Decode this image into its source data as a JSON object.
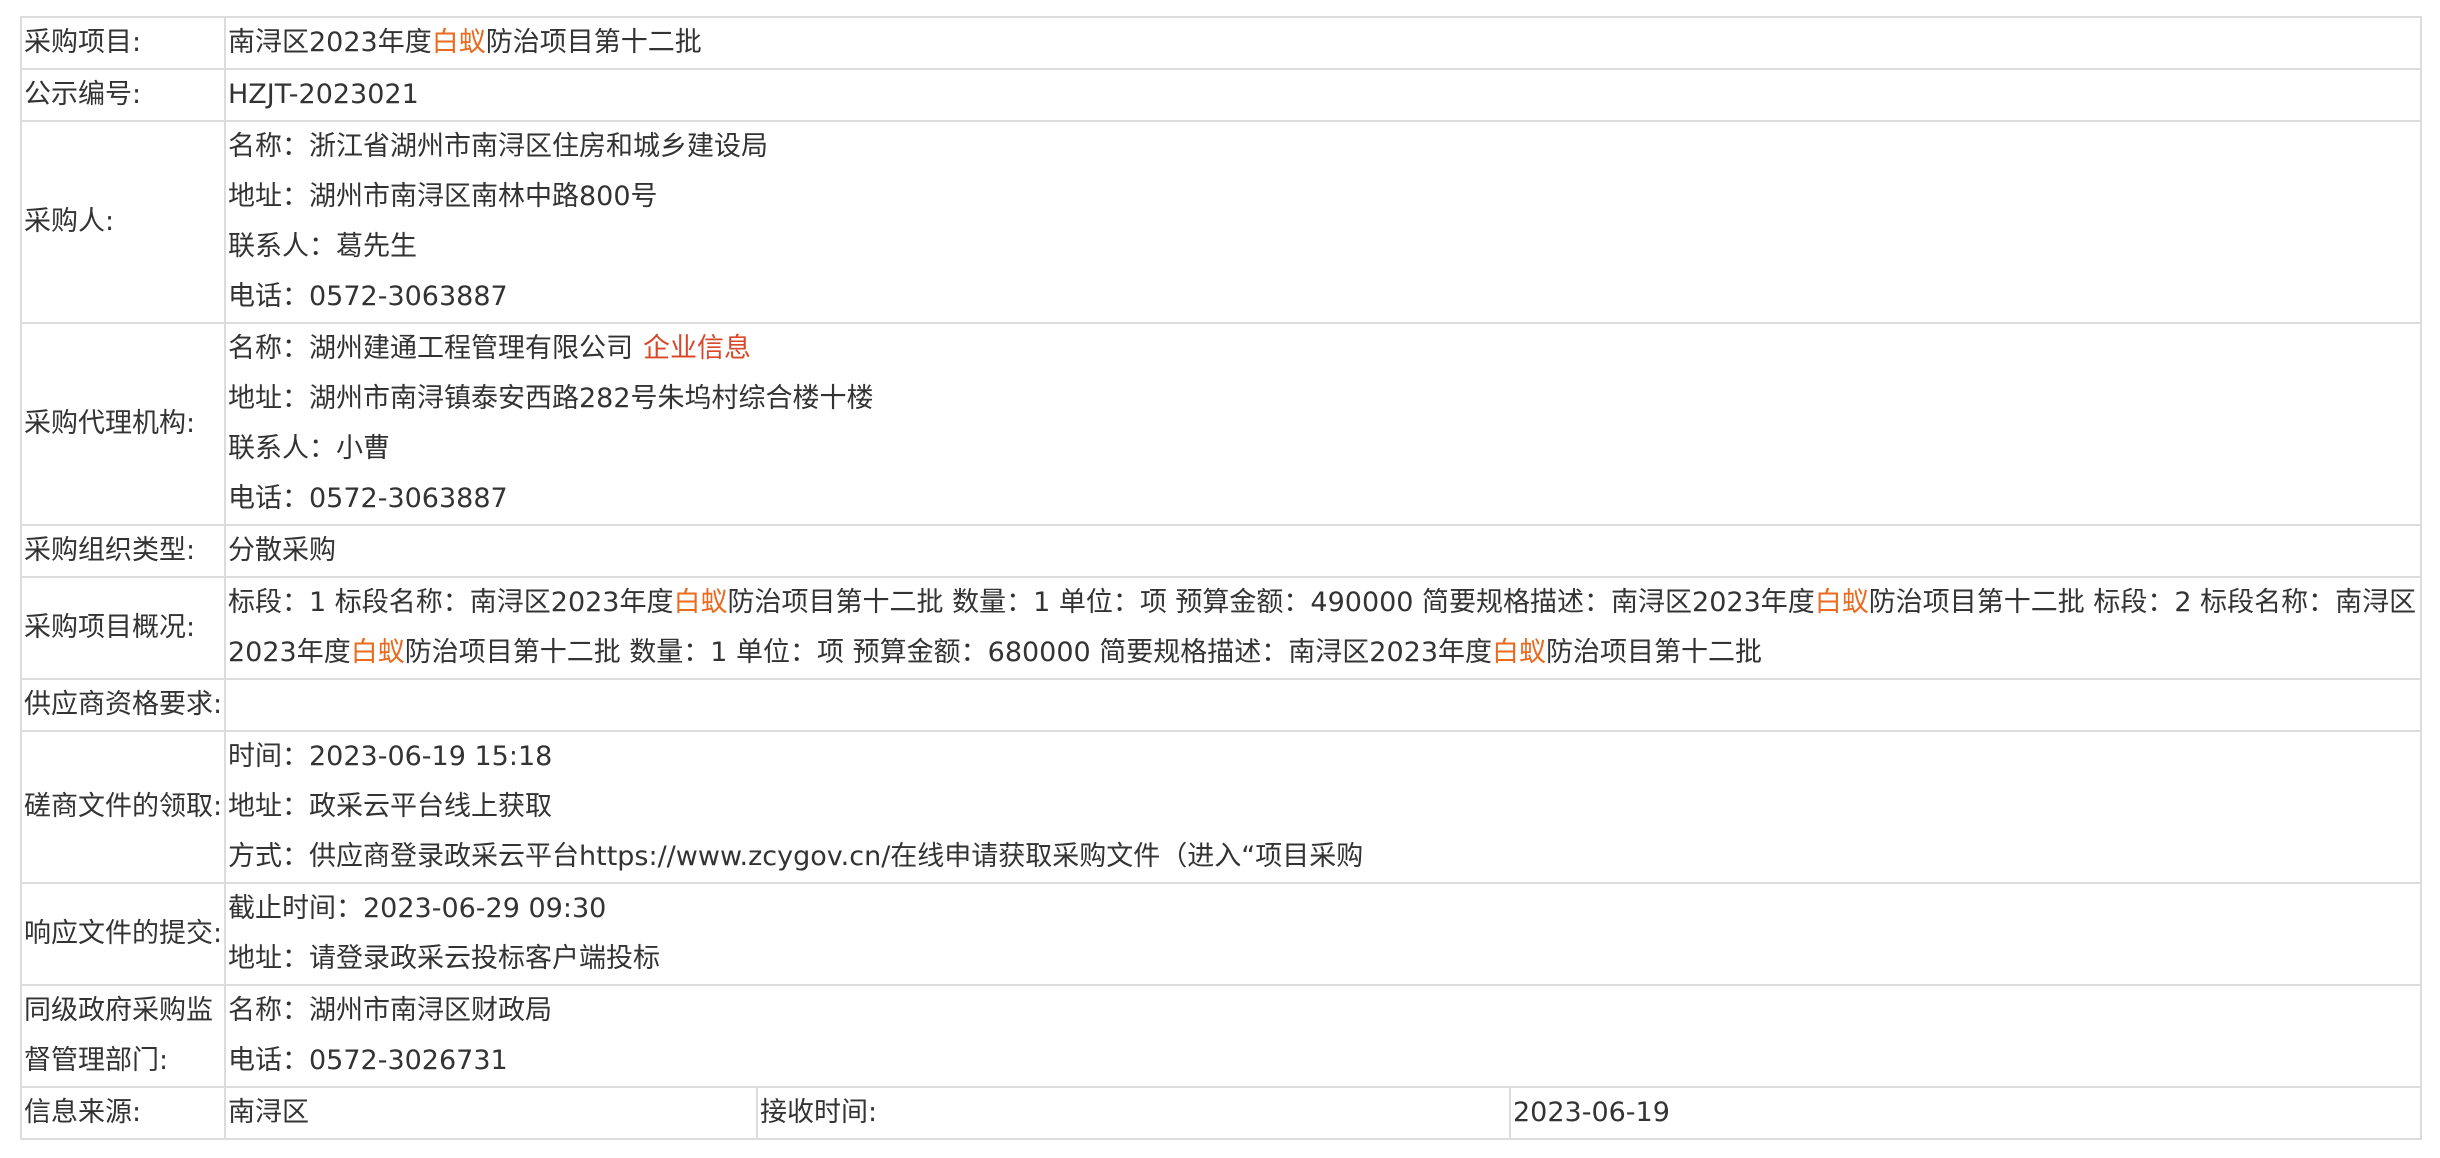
{
  "highlight_color": "#ea6a1f",
  "link_color": "#d9482b",
  "project": {
    "label": "采购项目:",
    "pre": "南浔区2023年度",
    "hl": "白蚁",
    "post": "防治项目第十二批"
  },
  "notice_no": {
    "label": "公示编号:",
    "value": "HZJT-2023021"
  },
  "purchaser": {
    "label": "采购人:",
    "name": "名称：浙江省湖州市南浔区住房和城乡建设局",
    "address": "地址：湖州市南浔区南林中路800号",
    "contact": "联系人：葛先生",
    "phone": "电话：0572-3063887"
  },
  "agency": {
    "label": "采购代理机构:",
    "name": "名称：湖州建通工程管理有限公司",
    "company_link": "企业信息",
    "address": "地址：湖州市南浔镇泰安西路282号朱坞村综合楼十楼",
    "contact": "联系人：小曹",
    "phone": "电话：0572-3063887"
  },
  "org_type": {
    "label": "采购组织类型:",
    "value": "分散采购"
  },
  "overview": {
    "label": "采购项目概况:",
    "parts": [
      "标段：1 标段名称：南浔区2023年度",
      "白蚁",
      "防治项目第十二批 数量：1 单位：项 预算金额：490000 简要规格描述：南浔区2023年度",
      "白蚁",
      "防治项目第十二批 标段：2 标段名称：南浔区2023年度",
      "白蚁",
      "防治项目第十二批 数量：1 单位：项 预算金额：680000 简要规格描述：南浔区2023年度",
      "白蚁",
      "防治项目第十二批"
    ]
  },
  "supplier_req": {
    "label": "供应商资格要求:",
    "value": ""
  },
  "doc_obtain": {
    "label": "磋商文件的领取:",
    "time": "时间：2023-06-19 15:18",
    "address": "地址：政采云平台线上获取",
    "method": "方式：供应商登录政采云平台https://www.zcygov.cn/在线申请获取采购文件（进入“项目采购"
  },
  "submission": {
    "label": "响应文件的提交:",
    "deadline": "截止时间：2023-06-29 09:30",
    "address": "地址：请登录政采云投标客户端投标"
  },
  "supervisor": {
    "label": "同级政府采购监督管理部门:",
    "name": "名称：湖州市南浔区财政局",
    "phone": "电话：0572-3026731"
  },
  "footer": {
    "source_label": "信息来源:",
    "source_value": "南浔区",
    "received_label": "接收时间:",
    "received_value": "2023-06-19"
  }
}
